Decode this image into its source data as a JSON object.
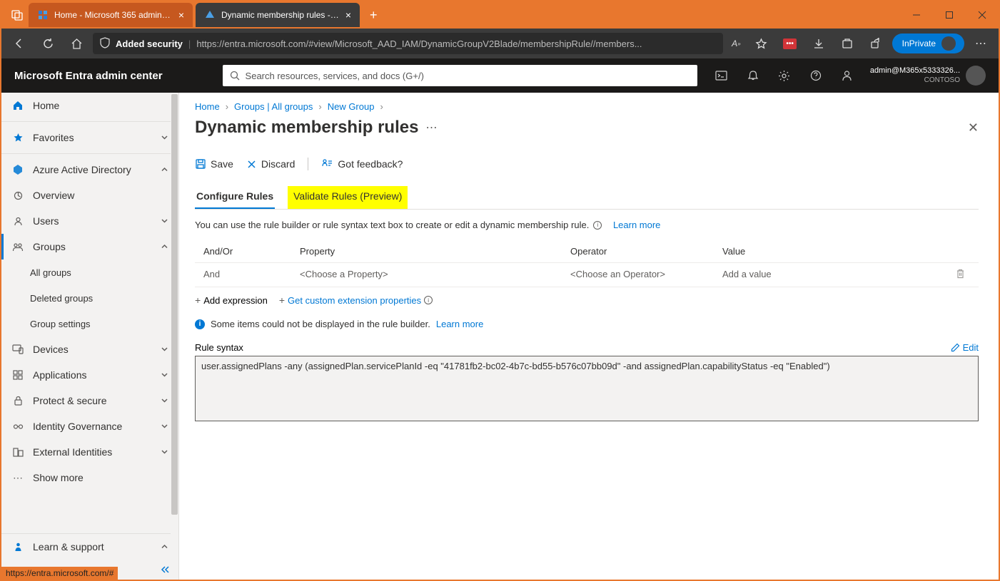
{
  "browser": {
    "tabs": [
      {
        "label": "Home - Microsoft 365 admin cen"
      },
      {
        "label": "Dynamic membership rules - Mic"
      }
    ],
    "security_label": "Added security",
    "url": "https://entra.microsoft.com/#view/Microsoft_AAD_IAM/DynamicGroupV2Blade/membershipRule//members...",
    "inprivate": "InPrivate",
    "status_url": "https://entra.microsoft.com/#",
    "ext_badge": "•••"
  },
  "topbar": {
    "title": "Microsoft Entra admin center",
    "search_placeholder": "Search resources, services, and docs (G+/)",
    "user": "admin@M365x5333326...",
    "tenant": "CONTOSO"
  },
  "sidebar": {
    "home": "Home",
    "favorites": "Favorites",
    "aad": "Azure Active Directory",
    "overview": "Overview",
    "users": "Users",
    "groups": "Groups",
    "all_groups": "All groups",
    "deleted_groups": "Deleted groups",
    "group_settings": "Group settings",
    "devices": "Devices",
    "applications": "Applications",
    "protect": "Protect & secure",
    "identity_gov": "Identity Governance",
    "external": "External Identities",
    "show_more": "Show more",
    "learn": "Learn & support"
  },
  "breadcrumbs": {
    "home": "Home",
    "groups": "Groups | All groups",
    "new_group": "New Group"
  },
  "page": {
    "title": "Dynamic membership rules",
    "save": "Save",
    "discard": "Discard",
    "feedback": "Got feedback?",
    "tab_configure": "Configure Rules",
    "tab_validate": "Validate Rules (Preview)",
    "helper": "You can use the rule builder or rule syntax text box to create or edit a dynamic membership rule.",
    "learn_more": "Learn more",
    "cols": {
      "and_or": "And/Or",
      "property": "Property",
      "operator": "Operator",
      "value": "Value"
    },
    "row": {
      "and": "And",
      "prop": "<Choose a Property>",
      "op": "<Choose an Operator>",
      "val": "Add a value"
    },
    "add_expr": "Add expression",
    "get_ext": "Get custom extension properties",
    "info_msg": "Some items could not be displayed in the rule builder.",
    "rule_syntax_label": "Rule syntax",
    "edit": "Edit",
    "syntax": "user.assignedPlans -any (assignedPlan.servicePlanId -eq \"41781fb2-bc02-4b7c-bd55-b576c07bb09d\" -and assignedPlan.capabilityStatus -eq \"Enabled\")"
  }
}
